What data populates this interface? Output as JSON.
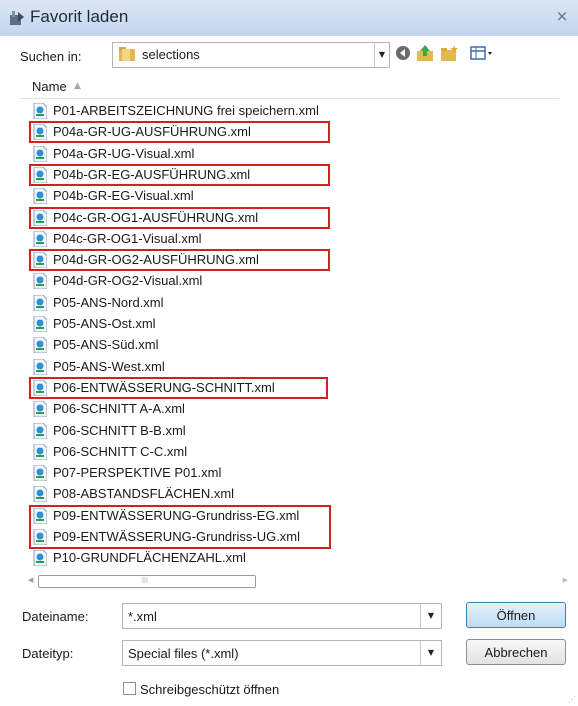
{
  "dialog": {
    "title": "Favorit laden",
    "close": "×"
  },
  "lookin": {
    "label": "Suchen in:",
    "value": "selections"
  },
  "list": {
    "header": "Name",
    "files": [
      "P01-ARBEITSZEICHNUNG frei speichern.xml",
      "P04a-GR-UG-AUSFÜHRUNG.xml",
      "P04a-GR-UG-Visual.xml",
      "P04b-GR-EG-AUSFÜHRUNG.xml",
      "P04b-GR-EG-Visual.xml",
      "P04c-GR-OG1-AUSFÜHRUNG.xml",
      "P04c-GR-OG1-Visual.xml",
      "P04d-GR-OG2-AUSFÜHRUNG.xml",
      "P04d-GR-OG2-Visual.xml",
      "P05-ANS-Nord.xml",
      "P05-ANS-Ost.xml",
      "P05-ANS-Süd.xml",
      "P05-ANS-West.xml",
      "P06-ENTWÄSSERUNG-SCHNITT.xml",
      "P06-SCHNITT A-A.xml",
      "P06-SCHNITT B-B.xml",
      "P06-SCHNITT C-C.xml",
      "P07-PERSPEKTIVE P01.xml",
      "P08-ABSTANDSFLÄCHEN.xml",
      "P09-ENTWÄSSERUNG-Grundriss-EG.xml",
      "P09-ENTWÄSSERUNG-Grundriss-UG.xml",
      "P10-GRUNDFLÄCHENZAHL.xml"
    ]
  },
  "filename": {
    "label": "Dateiname:",
    "value": "*.xml"
  },
  "filetype": {
    "label": "Dateityp:",
    "value": "Special files  (*.xml)"
  },
  "buttons": {
    "open": "Öffnen",
    "cancel": "Abbrechen"
  },
  "readonly": {
    "label": "Schreibgeschützt öffnen"
  },
  "colors": {
    "highlight": "#d42020",
    "titlebar": "#c3d5ee"
  }
}
